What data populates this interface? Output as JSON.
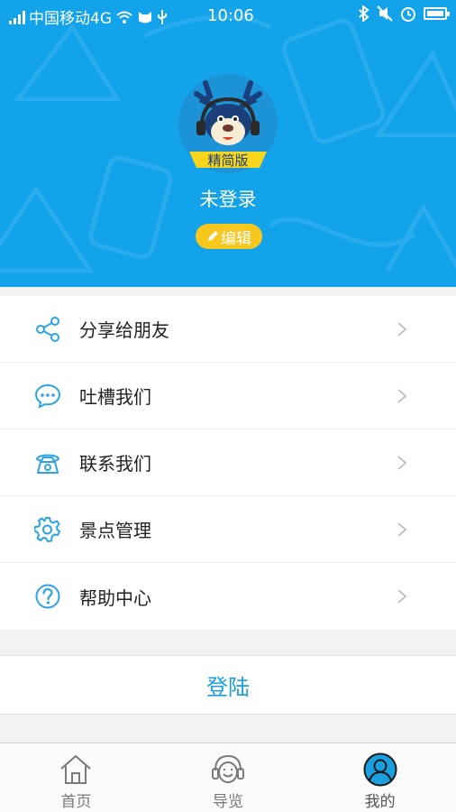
{
  "status_bar": {
    "carrier": "中国移动4G",
    "time": "10:06"
  },
  "profile": {
    "avatar_badge": "精简版",
    "login_state": "未登录",
    "edit_label": "编辑"
  },
  "menu": {
    "items": [
      {
        "label": "分享给朋友",
        "icon": "share-icon"
      },
      {
        "label": "吐槽我们",
        "icon": "chat-bubble-icon"
      },
      {
        "label": "联系我们",
        "icon": "telephone-icon"
      },
      {
        "label": "景点管理",
        "icon": "gear-icon"
      },
      {
        "label": "帮助中心",
        "icon": "help-icon"
      }
    ]
  },
  "login_button": "登陆",
  "tabbar": {
    "tabs": [
      {
        "label": "首页",
        "icon": "home-icon"
      },
      {
        "label": "导览",
        "icon": "headphone-guide-icon"
      },
      {
        "label": "我的",
        "icon": "profile-icon",
        "active": true
      }
    ]
  },
  "colors": {
    "header_blue": "#13a3eb",
    "accent_blue": "#1aa0e0",
    "edit_yellow": "#f7c71d"
  }
}
